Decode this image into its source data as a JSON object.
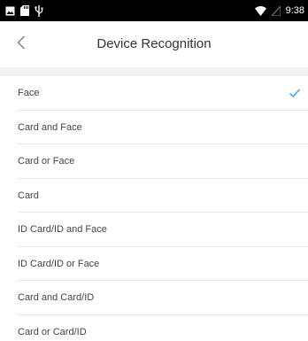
{
  "status_bar": {
    "time": "9:38",
    "left_icons": [
      "image-icon",
      "sd-card-icon",
      "usb-icon"
    ],
    "right_icons": [
      "wifi-icon",
      "signal-icon"
    ]
  },
  "header": {
    "title": "Device Recognition",
    "back_icon": "chevron-left-icon"
  },
  "options": [
    {
      "label": "Face",
      "selected": true
    },
    {
      "label": "Card and Face",
      "selected": false
    },
    {
      "label": "Card or Face",
      "selected": false
    },
    {
      "label": "Card",
      "selected": false
    },
    {
      "label": "ID Card/ID and Face",
      "selected": false
    },
    {
      "label": "ID Card/ID or Face",
      "selected": false
    },
    {
      "label": "Card and Card/ID",
      "selected": false
    },
    {
      "label": "Card or Card/ID",
      "selected": false
    }
  ],
  "colors": {
    "accent": "#3d9be9",
    "text": "#444444",
    "title": "#333333",
    "divider": "#e6e6e6",
    "band": "#f2f2f2"
  }
}
